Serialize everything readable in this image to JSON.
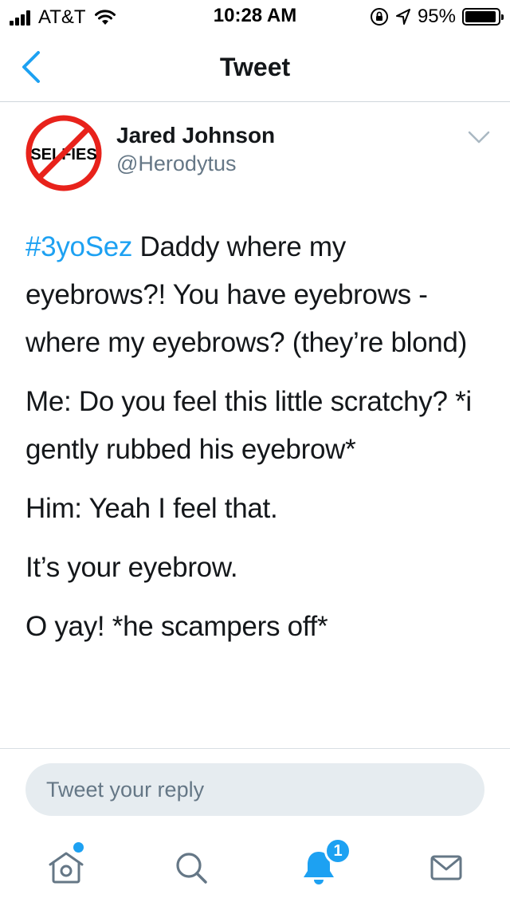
{
  "status_bar": {
    "carrier": "AT&T",
    "time": "10:28 AM",
    "battery_percent": "95%",
    "battery_level": 0.95,
    "icons": [
      "signal-icon",
      "wifi-icon",
      "orientation-lock-icon",
      "location-icon",
      "battery-icon"
    ]
  },
  "nav": {
    "title": "Tweet",
    "back_icon": "chevron-left-icon"
  },
  "tweet": {
    "author_name": "Jared Johnson",
    "author_handle": "@Herodytus",
    "avatar_text": "SELFIES",
    "menu_icon": "chevron-down-icon",
    "hashtag": "#3yoSez",
    "first_text": " Daddy where my eyebrows?! You have eyebrows - where my eyebrows? (they’re blond)",
    "paragraphs": [
      "Me: Do you feel this little scratchy? *i gently rubbed his eyebrow*",
      "Him: Yeah I feel that.",
      "It’s your eyebrow.",
      "O yay! *he scampers off*"
    ]
  },
  "reply": {
    "placeholder": "Tweet your reply"
  },
  "tab_bar": {
    "tabs": [
      "home-icon",
      "search-icon",
      "notifications-icon",
      "messages-icon"
    ],
    "notification_count": "1"
  },
  "colors": {
    "accent": "#1da1f2",
    "text": "#14171a",
    "secondary_text": "#657786",
    "reply_bg": "#e6ecf0",
    "avatar_red": "#e8221b"
  }
}
